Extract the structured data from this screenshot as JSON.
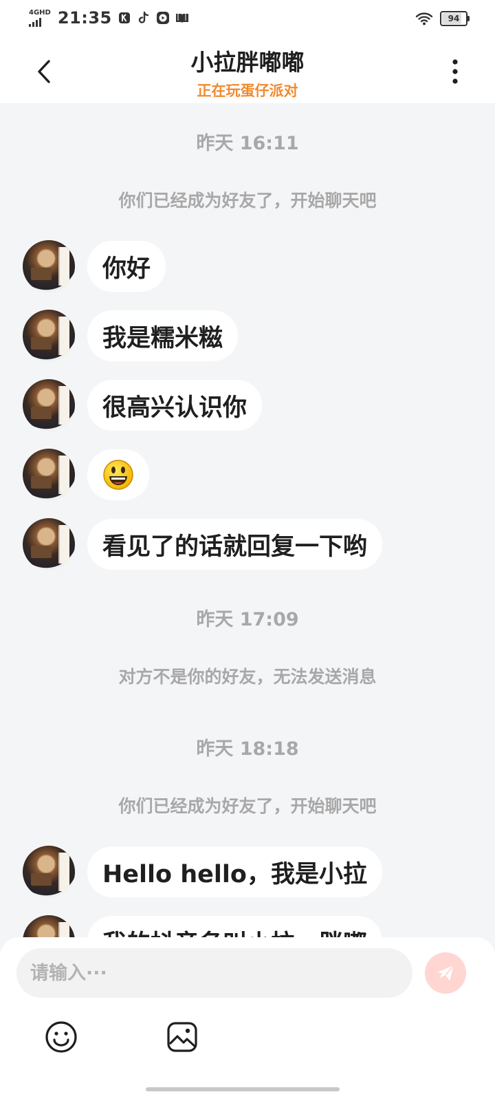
{
  "status_bar": {
    "network": "4GHD",
    "time": "21:35",
    "battery": "94",
    "battery_level": 0.94
  },
  "header": {
    "title": "小拉胖嘟嘟",
    "subtitle": "正在玩蛋仔派对"
  },
  "chat": {
    "groups": [
      {
        "timestamp": "昨天 16:11",
        "system": "你们已经成为好友了，开始聊天吧",
        "messages": [
          "你好",
          "我是糯米糍",
          "很高兴认识你",
          "😃",
          "看见了的话就回复一下哟"
        ]
      },
      {
        "timestamp": "昨天 17:09",
        "system": "对方不是你的好友，无法发送消息"
      },
      {
        "timestamp": "昨天 18:18",
        "system": "你们已经成为好友了，开始聊天吧",
        "messages": [
          "Hello hello，我是小拉",
          "我的抖音名叫小拉一胖嘟"
        ]
      }
    ]
  },
  "input": {
    "placeholder": "请输入···"
  },
  "colors": {
    "accent": "#f08a2e",
    "background": "#f4f5f7",
    "send_button": "#ffd6d2"
  },
  "icons": [
    "signal-icon",
    "k-app-icon",
    "tiktok-icon",
    "play-icon",
    "book-icon",
    "wifi-icon",
    "back-icon",
    "more-icon",
    "send-icon",
    "emoji-icon",
    "image-icon"
  ]
}
